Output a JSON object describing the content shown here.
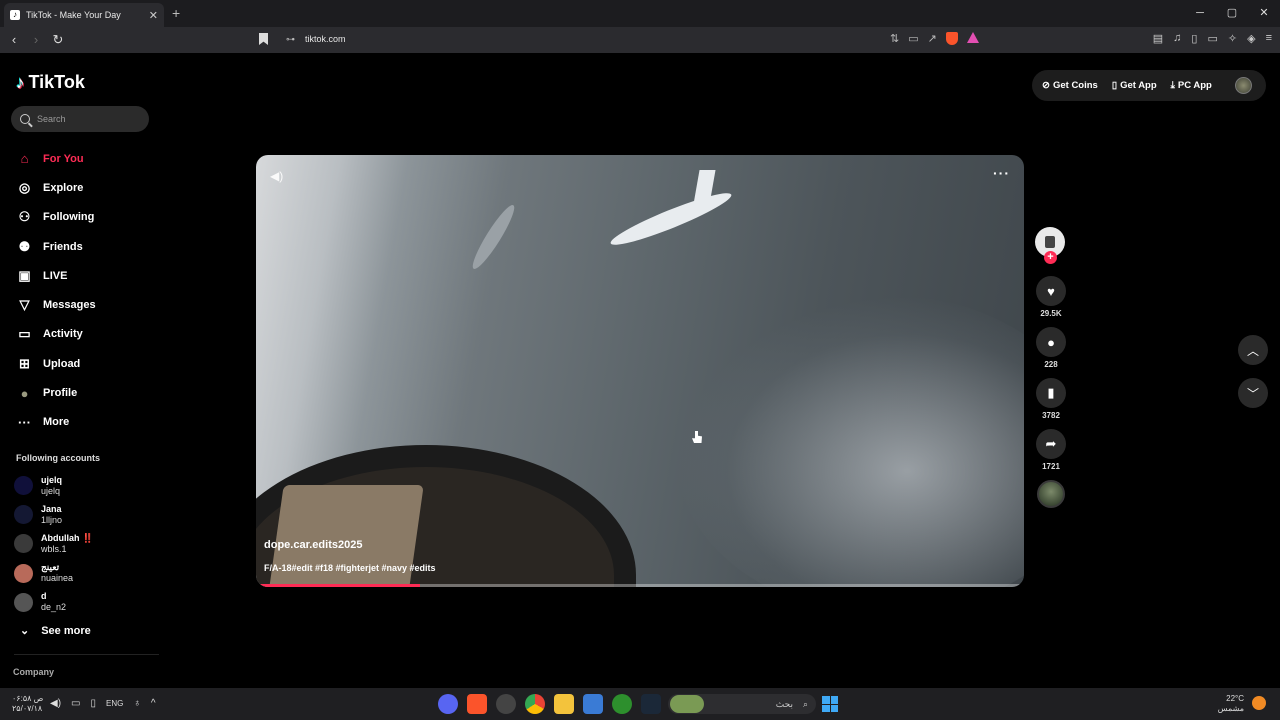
{
  "browser": {
    "tab_title": "TikTok - Make Your Day",
    "tab_close": "✕",
    "new_tab": "+",
    "url": "tiktok.com",
    "window_controls": [
      "─",
      "▢",
      "✕"
    ]
  },
  "sidebar": {
    "logo_text": "TikTok",
    "search_placeholder": "Search",
    "nav": [
      {
        "label": "For You",
        "icon": "home-icon",
        "glyph": "⌂"
      },
      {
        "label": "Explore",
        "icon": "compass-icon",
        "glyph": "◎"
      },
      {
        "label": "Following",
        "icon": "following-icon",
        "glyph": "⚇"
      },
      {
        "label": "Friends",
        "icon": "friends-icon",
        "glyph": "⚉"
      },
      {
        "label": "LIVE",
        "icon": "live-icon",
        "glyph": "▣"
      },
      {
        "label": "Messages",
        "icon": "messages-icon",
        "glyph": "▽"
      },
      {
        "label": "Activity",
        "icon": "activity-icon",
        "glyph": "▭"
      },
      {
        "label": "Upload",
        "icon": "upload-icon",
        "glyph": "⊞"
      },
      {
        "label": "Profile",
        "icon": "profile-icon",
        "glyph": "●"
      },
      {
        "label": "More",
        "icon": "more-icon",
        "glyph": "···"
      }
    ],
    "following_title": "Following accounts",
    "accounts": [
      {
        "name": "ujelq",
        "handle": "ujelq",
        "color": "#10103a"
      },
      {
        "name": "Jana",
        "handle": "1lljno",
        "color": "#141833"
      },
      {
        "name": "Abdullah ‼️",
        "handle": "wbls.1",
        "color": "#3a3a3a"
      },
      {
        "name": "تعينج",
        "handle": "nuainea",
        "color": "#b86a5a"
      },
      {
        "name": "d",
        "handle": "de_n2",
        "color": "#555555"
      }
    ],
    "see_more": "See more",
    "company": "Company"
  },
  "top_right": {
    "get_coins": "Get Coins",
    "get_app": "Get App",
    "pc_app": "PC App"
  },
  "video": {
    "author": "dope.car.edits2025",
    "caption": "F/A-18#edit #f18 #fighterjet #navy #edits",
    "progress": 0.21
  },
  "actions": {
    "likes": "29.5K",
    "comments": "228",
    "saves": "3782",
    "shares": "1721"
  },
  "taskbar": {
    "time_line1": "۰۶:۵۸ ص",
    "time_line2": "۲۵/۰۷/۱۸",
    "lang": "ENG",
    "search_text": "بحث",
    "temp": "22°C",
    "weather": "مشمس"
  },
  "colors": {
    "accent": "#fe2c55",
    "background": "#000000"
  }
}
